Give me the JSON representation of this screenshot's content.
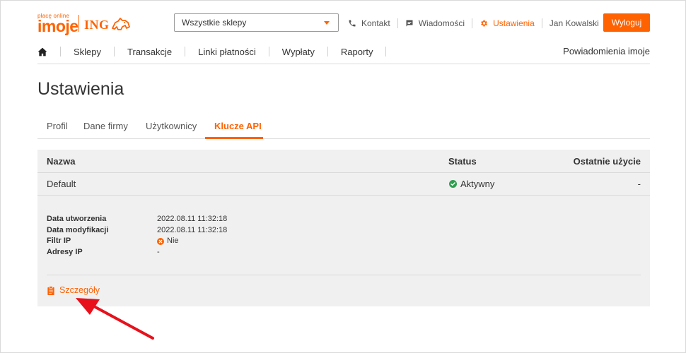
{
  "header": {
    "logo_tagline": "płacę online",
    "logo_brand": "imoje",
    "logo_partner": "ING",
    "store_select": {
      "value": "Wszystkie sklepy"
    },
    "links": {
      "contact": "Kontakt",
      "messages": "Wiadomości",
      "settings": "Ustawienia",
      "user": "Jan Kowalski"
    },
    "logout_label": "Wyloguj"
  },
  "nav": {
    "items": [
      "Sklepy",
      "Transakcje",
      "Linki płatności",
      "Wypłaty",
      "Raporty"
    ],
    "right_label": "Powiadomienia imoje"
  },
  "page_title": "Ustawienia",
  "tabs": [
    {
      "label": "Profil"
    },
    {
      "label": "Dane firmy"
    },
    {
      "label": "Użytkownicy"
    },
    {
      "label": "Klucze API",
      "active": true
    }
  ],
  "table": {
    "headers": {
      "name": "Nazwa",
      "status": "Status",
      "last_used": "Ostatnie użycie"
    },
    "rows": [
      {
        "name": "Default",
        "status": "Aktywny",
        "last_used": "-",
        "details": {
          "created_label": "Data utworzenia",
          "created_value": "2022.08.11 11:32:18",
          "modified_label": "Data modyfikacji",
          "modified_value": "2022.08.11 11:32:18",
          "ip_filter_label": "Filtr IP",
          "ip_filter_value": "Nie",
          "ip_addresses_label": "Adresy IP",
          "ip_addresses_value": "-"
        },
        "details_link": "Szczegóły"
      }
    ]
  },
  "colors": {
    "accent": "#ff6200",
    "success": "#2e9e4f",
    "error": "#ff6200",
    "table_bg": "#f0f0f0",
    "annotation_arrow": "#e8101b"
  },
  "icons": {
    "home": "home-icon",
    "contact": "phone-icon",
    "messages": "message-icon",
    "settings": "gear-icon",
    "status_active": "check-circle-icon",
    "ip_filter_off": "x-circle-icon",
    "details": "clipboard-icon"
  }
}
